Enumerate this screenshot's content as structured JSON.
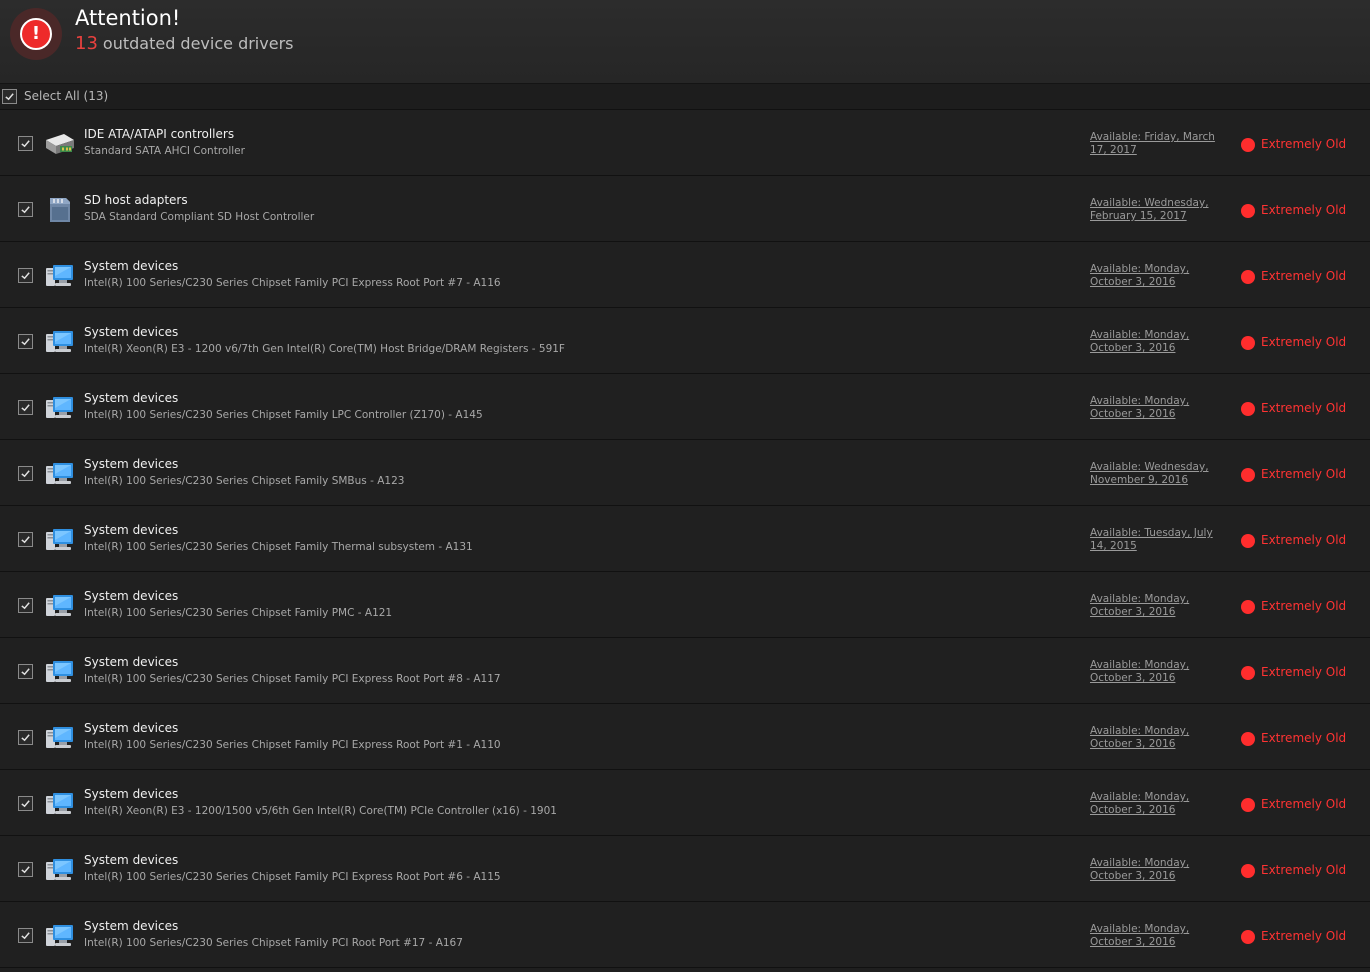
{
  "header": {
    "title": "Attention!",
    "count": "13",
    "subtitle": "outdated device drivers"
  },
  "select_all": {
    "label": "Select All (13)",
    "checked": true
  },
  "devices": [
    {
      "category": "IDE ATA/ATAPI controllers",
      "description": "Standard SATA AHCI Controller",
      "available": "Available: Friday, March 17, 2017",
      "status": "Extremely Old",
      "icon": "ide-controller-icon"
    },
    {
      "category": "SD host adapters",
      "description": "SDA Standard Compliant SD Host Controller",
      "available": "Available: Wednesday, February 15, 2017",
      "status": "Extremely Old",
      "icon": "sd-adapter-icon"
    },
    {
      "category": "System devices",
      "description": "Intel(R) 100 Series/C230 Series Chipset Family PCI Express Root Port #7 - A116",
      "available": "Available: Monday, October 3, 2016",
      "status": "Extremely Old",
      "icon": "computer-icon"
    },
    {
      "category": "System devices",
      "description": "Intel(R) Xeon(R) E3 - 1200 v6/7th Gen Intel(R) Core(TM) Host Bridge/DRAM Registers - 591F",
      "available": "Available: Monday, October 3, 2016",
      "status": "Extremely Old",
      "icon": "computer-icon"
    },
    {
      "category": "System devices",
      "description": "Intel(R) 100 Series/C230 Series Chipset Family LPC Controller (Z170) - A145",
      "available": "Available: Monday, October 3, 2016",
      "status": "Extremely Old",
      "icon": "computer-icon"
    },
    {
      "category": "System devices",
      "description": "Intel(R) 100 Series/C230 Series Chipset Family SMBus - A123",
      "available": "Available: Wednesday, November 9, 2016",
      "status": "Extremely Old",
      "icon": "computer-icon"
    },
    {
      "category": "System devices",
      "description": "Intel(R) 100 Series/C230 Series Chipset Family Thermal subsystem - A131",
      "available": "Available: Tuesday, July 14, 2015",
      "status": "Extremely Old",
      "icon": "computer-icon"
    },
    {
      "category": "System devices",
      "description": "Intel(R) 100 Series/C230 Series Chipset Family PMC - A121",
      "available": "Available: Monday, October 3, 2016",
      "status": "Extremely Old",
      "icon": "computer-icon"
    },
    {
      "category": "System devices",
      "description": "Intel(R) 100 Series/C230 Series Chipset Family PCI Express Root Port #8 - A117",
      "available": "Available: Monday, October 3, 2016",
      "status": "Extremely Old",
      "icon": "computer-icon"
    },
    {
      "category": "System devices",
      "description": "Intel(R) 100 Series/C230 Series Chipset Family PCI Express Root Port #1 - A110",
      "available": "Available: Monday, October 3, 2016",
      "status": "Extremely Old",
      "icon": "computer-icon"
    },
    {
      "category": "System devices",
      "description": "Intel(R) Xeon(R) E3 - 1200/1500 v5/6th Gen Intel(R) Core(TM) PCIe Controller (x16) - 1901",
      "available": "Available: Monday, October 3, 2016",
      "status": "Extremely Old",
      "icon": "computer-icon"
    },
    {
      "category": "System devices",
      "description": "Intel(R) 100 Series/C230 Series Chipset Family PCI Express Root Port #6 - A115",
      "available": "Available: Monday, October 3, 2016",
      "status": "Extremely Old",
      "icon": "computer-icon"
    },
    {
      "category": "System devices",
      "description": "Intel(R) 100 Series/C230 Series Chipset Family PCI Root Port #17 - A167",
      "available": "Available: Monday, October 3, 2016",
      "status": "Extremely Old",
      "icon": "computer-icon"
    }
  ],
  "colors": {
    "accent_red": "#ff3333",
    "background": "#202020"
  }
}
